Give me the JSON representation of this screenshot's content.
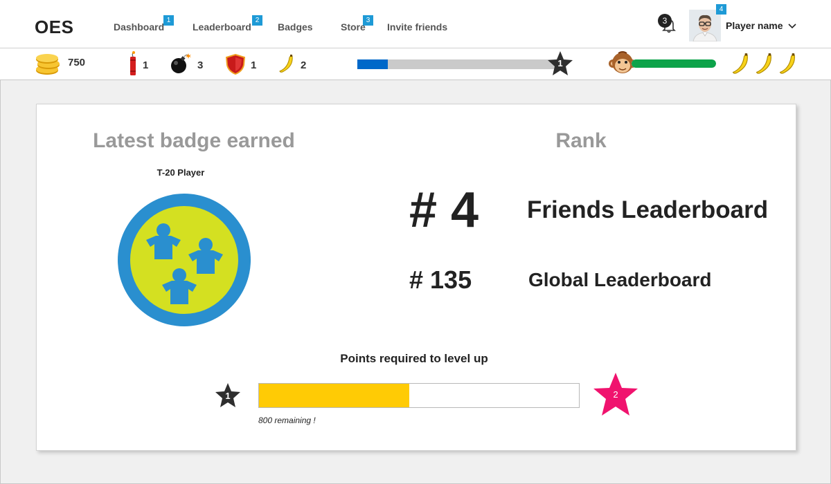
{
  "app": {
    "logo": "OES"
  },
  "nav": {
    "items": [
      {
        "label": "Dashboard",
        "badge": "1"
      },
      {
        "label": "Leaderboard",
        "badge": "2"
      },
      {
        "label": "Badges",
        "badge": ""
      },
      {
        "label": "Store",
        "badge": "3"
      },
      {
        "label": "Invite friends",
        "badge": ""
      }
    ]
  },
  "user": {
    "notifications": "3",
    "avatar_badge": "4",
    "name": "Player name"
  },
  "stats": {
    "coins": "750",
    "dynamite": "1",
    "bombs": "3",
    "shields": "1",
    "bananas": "2",
    "xp_fraction": 0.15,
    "level": "1",
    "monkey_fraction": 1.0,
    "banana_lives": 3
  },
  "card": {
    "badge_heading": "Latest badge earned",
    "badge_name": "T-20 Player",
    "rank_heading": "Rank",
    "friends_rank": "# 4",
    "friends_label": "Friends Leaderboard",
    "global_rank": "# 135",
    "global_label": "Global Leaderboard",
    "points_title": "Points required to level up",
    "current_level": "1",
    "next_level": "2",
    "progress_fraction": 0.47,
    "remaining_text": "800 remaining !"
  },
  "colors": {
    "accent_blue": "#1e9ad6",
    "xp_blue": "#0068c9",
    "monkey_green": "#0da34a",
    "progress_yellow": "#ffcb05",
    "next_star_pink": "#f0136e",
    "badge_ring": "#2a8fcf",
    "badge_center": "#d4e021"
  },
  "icons": [
    "coins-icon",
    "dynamite-icon",
    "bomb-icon",
    "shield-icon",
    "banana-icon",
    "star-icon",
    "monkey-icon",
    "bell-icon",
    "chevron-down-icon",
    "badge-people-icon"
  ]
}
